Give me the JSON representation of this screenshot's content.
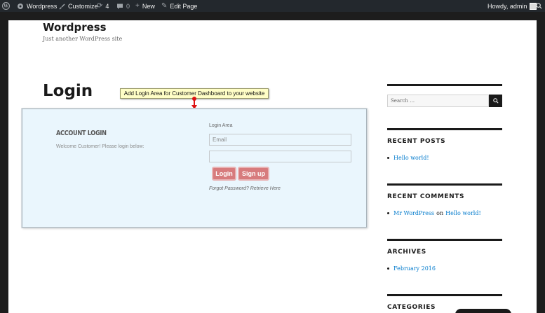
{
  "adminbar": {
    "site_name": "Wordpress",
    "customize": "Customize",
    "updates_count": "4",
    "comments_count": "0",
    "new": "New",
    "edit_page": "Edit Page",
    "howdy": "Howdy, admin"
  },
  "site": {
    "title": "Wordpress",
    "description": "Just another WordPress site"
  },
  "page": {
    "title": "Login",
    "tooltip": "Add Login Area for Customer Dashboard to your website"
  },
  "login_box": {
    "heading": "Account Login",
    "welcome": "Welcome Customer! Please login below:",
    "area_label": "Login Area",
    "email_placeholder": "Email",
    "password_placeholder": "",
    "login_button": "Login",
    "signup_button": "Sign up",
    "forgot": "Forgot Password? Retrieve Here"
  },
  "sidebar": {
    "search_placeholder": "Search …",
    "recent_posts": {
      "title": "Recent Posts",
      "items": [
        "Hello world!"
      ]
    },
    "recent_comments": {
      "title": "Recent Comments",
      "author": "Mr WordPress",
      "on": "on",
      "post": "Hello world!"
    },
    "archives": {
      "title": "Archives",
      "items": [
        "February 2016"
      ]
    },
    "categories": {
      "title": "Categories"
    }
  },
  "colors": {
    "adminbar_bg": "#23282d",
    "link": "#007acc",
    "login_box_bg": "#eaf6fd",
    "button": "#d77b7d",
    "tooltip_bg": "#fffec6",
    "arrow": "#dd1111"
  }
}
